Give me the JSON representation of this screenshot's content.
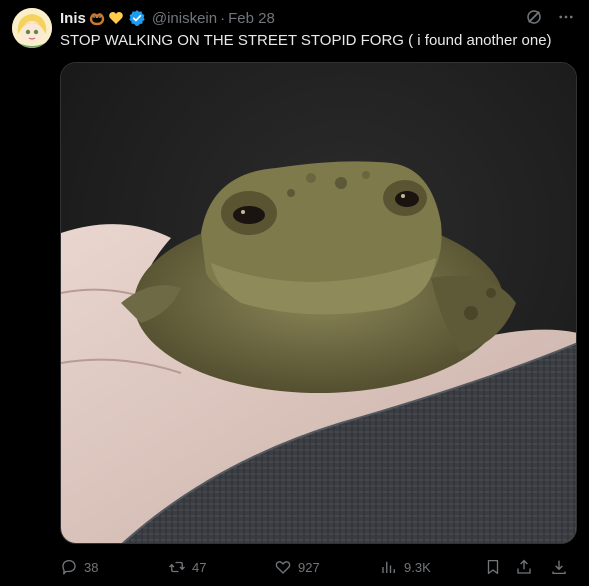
{
  "tweet": {
    "author": {
      "display_name": "Inis",
      "name_emojis": [
        "pretzel-emoji",
        "yellow-heart-emoji"
      ],
      "verified": true,
      "handle": "@iniskein"
    },
    "separator": "·",
    "date": "Feb 28",
    "text": "STOP WALKING ON THE STREET STOPID FORG ( i found another one)",
    "media": {
      "subject": "toad",
      "kind": "photo"
    },
    "actions": {
      "replies": "38",
      "reposts": "47",
      "likes": "927",
      "views": "9.3K"
    }
  },
  "colors": {
    "background": "#000000",
    "text_primary": "#e7e9ea",
    "text_secondary": "#71767b",
    "verified_blue": "#1d9bf0",
    "border": "#2f3336"
  }
}
